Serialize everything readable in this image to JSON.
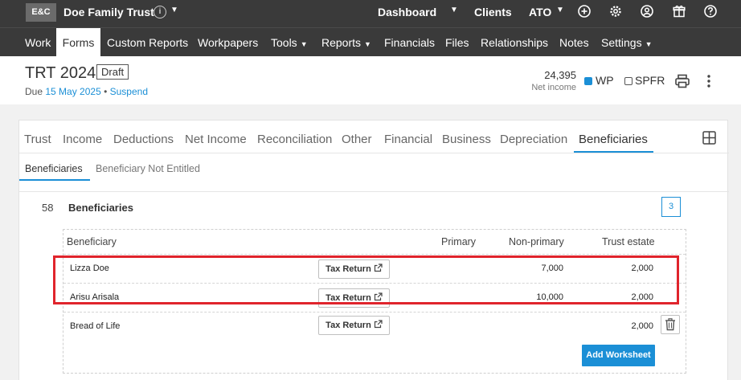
{
  "topbar": {
    "logo": "E&C",
    "client_name": "Doe Family Trust",
    "info": "i",
    "links": [
      "Dashboard",
      "Clients",
      "ATO"
    ]
  },
  "nav": {
    "items": [
      "Work",
      "Forms",
      "Custom Reports",
      "Workpapers",
      "Tools",
      "Reports",
      "Financials",
      "Files",
      "Relationships",
      "Notes",
      "Settings"
    ],
    "active": "Forms"
  },
  "header": {
    "title": "TRT 2024",
    "status": "Draft",
    "due_prefix": "Due ",
    "due_date": "15 May 2025",
    "separator": " • ",
    "suspend": "Suspend",
    "net_income_value": "24,395",
    "net_income_label": "Net income",
    "wp_label": "WP",
    "spfr_label": "SPFR"
  },
  "tabs": [
    "Trust",
    "Income",
    "Deductions",
    "Net Income",
    "Reconciliation",
    "Other",
    "Financial",
    "Business",
    "Depreciation",
    "Beneficiaries"
  ],
  "active_tab": "Beneficiaries",
  "subtabs": [
    "Beneficiaries",
    "Beneficiary Not Entitled"
  ],
  "section": {
    "number": "58",
    "title": "Beneficiaries",
    "count": "3"
  },
  "table": {
    "headers": [
      "Beneficiary",
      "Primary",
      "Non-primary",
      "Trust estate"
    ],
    "rows": [
      {
        "name": "Lizza Doe",
        "button": "Tax Return",
        "primary": "",
        "non_primary": "7,000",
        "trust_estate": "2,000"
      },
      {
        "name": "Arisu Arisala",
        "button": "Tax Return",
        "primary": "",
        "non_primary": "10,000",
        "trust_estate": "2,000"
      },
      {
        "name": "Bread of Life",
        "button": "Tax Return",
        "primary": "",
        "non_primary": "",
        "trust_estate": "2,000"
      }
    ],
    "add_button": "Add Worksheet"
  },
  "colors": {
    "topbar_bg": "#3a3a3a",
    "accent_blue": "#1b8fd6",
    "highlight_red": "#e0242c"
  }
}
